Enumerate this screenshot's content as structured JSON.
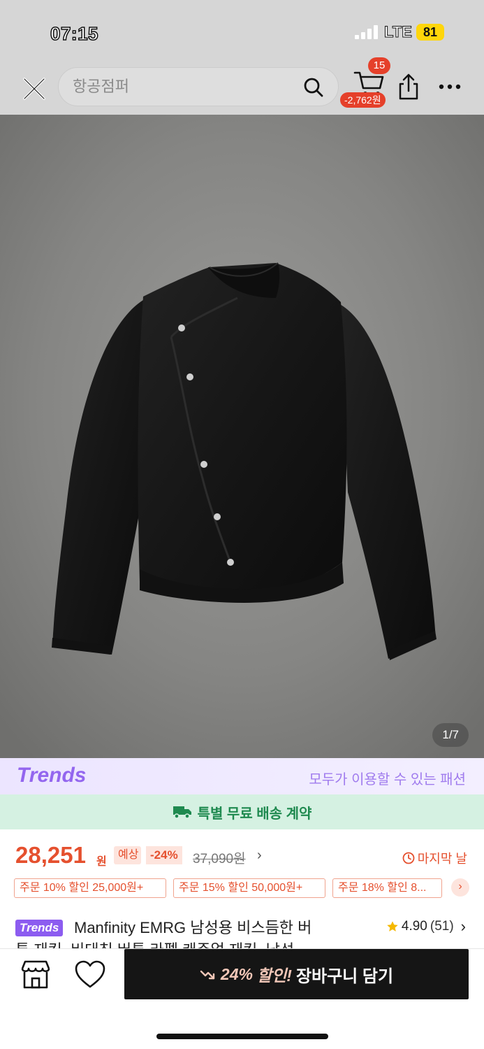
{
  "status_bar": {
    "time": "07:15",
    "network": "LTE",
    "battery": "81"
  },
  "header": {
    "search_placeholder": "항공점퍼",
    "cart_count": "15",
    "cart_discount": "-2,762원"
  },
  "gallery": {
    "counter": "1/7"
  },
  "trends_banner": {
    "logo": "Trends",
    "tagline": "모두가 이용할 수 있는 패션"
  },
  "shipping": {
    "label": "특별 무료 배송 계약"
  },
  "price": {
    "value": "28,251",
    "unit": "원",
    "estimate_label": "예상",
    "discount": "-24%",
    "original": "37,090원",
    "chevron": "›",
    "deadline": "마지막 날"
  },
  "coupons": [
    "주문 10% 할인 25,000원+",
    "주문 15% 할인 50,000원+",
    "주문 18% 할인 8..."
  ],
  "product": {
    "badge": "Trends",
    "title_line1": "Manfinity EMRG 남성용 비스듬한 버",
    "title_line2": "튼 재킷, 비대칭 버튼 라펠 캐주얼 재킷, 남성",
    "rating": "4.90",
    "review_count": "(51)"
  },
  "bottom_bar": {
    "cta_percent": "24%",
    "cta_promo": "할인!",
    "cta_label": "장바구니 담기"
  },
  "colors": {
    "accent": "#e5502e",
    "trends_purple": "#9366ef",
    "shipping_green": "#1f8a50",
    "cta_bg": "#151515"
  }
}
